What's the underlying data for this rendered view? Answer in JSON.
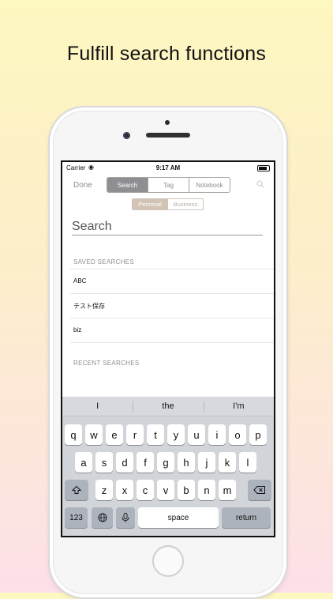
{
  "headline": "Fulfill search functions",
  "status_bar": {
    "carrier": "Carrier",
    "time": "9:17 AM"
  },
  "nav": {
    "done_label": "Done",
    "segments": [
      "Search",
      "Tag",
      "Notebook"
    ],
    "active_segment": "Search"
  },
  "scope": {
    "options": [
      "Personal",
      "Business"
    ],
    "active": "Personal"
  },
  "search": {
    "placeholder": "Search",
    "value": ""
  },
  "saved_searches": {
    "header": "SAVED SEARCHES",
    "items": [
      "ABC",
      "テスト保存",
      "biz"
    ]
  },
  "recent_searches": {
    "header": "RECENT SEARCHES",
    "items": []
  },
  "keyboard": {
    "predictions": [
      "I",
      "the",
      "I'm"
    ],
    "row1": [
      "q",
      "w",
      "e",
      "r",
      "t",
      "y",
      "u",
      "i",
      "o",
      "p"
    ],
    "row2": [
      "a",
      "s",
      "d",
      "f",
      "g",
      "h",
      "j",
      "k",
      "l"
    ],
    "row3": [
      "z",
      "x",
      "c",
      "v",
      "b",
      "n",
      "m"
    ],
    "numbers_label": "123",
    "space_label": "space",
    "return_label": "return"
  },
  "icons": {
    "shift": "shift-icon",
    "delete": "delete-icon",
    "globe": "globe-icon",
    "mic": "microphone-icon",
    "search": "search-icon",
    "wifi": "wifi-icon",
    "battery": "battery-icon"
  }
}
